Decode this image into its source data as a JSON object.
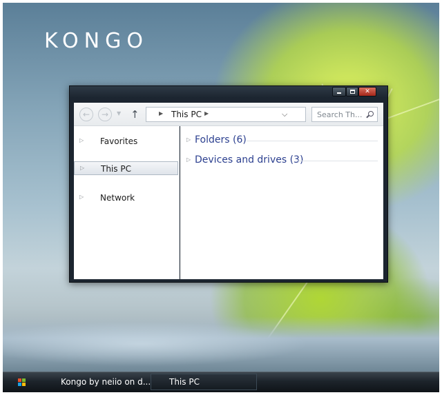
{
  "desktop": {
    "logo": "KONGO"
  },
  "window": {
    "controls": {
      "minimize_icon": "minimize-icon",
      "maximize_icon": "maximize-icon",
      "close_icon": "close-icon"
    },
    "toolbar": {
      "address_path": "This PC",
      "search_placeholder": "Search Th..."
    },
    "navigation_pane": {
      "items": [
        {
          "label": "Favorites",
          "selected": false
        },
        {
          "label": "This PC",
          "selected": true
        },
        {
          "label": "Network",
          "selected": false
        }
      ]
    },
    "content": {
      "groups": [
        {
          "label": "Folders (6)"
        },
        {
          "label": "Devices and drives (3)"
        }
      ]
    }
  },
  "taskbar": {
    "start_icon": "windows-logo-icon",
    "tasks": [
      {
        "label": "Kongo by neiio on d...",
        "active": false
      },
      {
        "label": "This PC",
        "active": true
      }
    ]
  },
  "colors": {
    "window_frame": "#1c2530",
    "group_text": "#2b3f8f",
    "close_button": "#c0392b",
    "taskbar": "#1d242b"
  }
}
